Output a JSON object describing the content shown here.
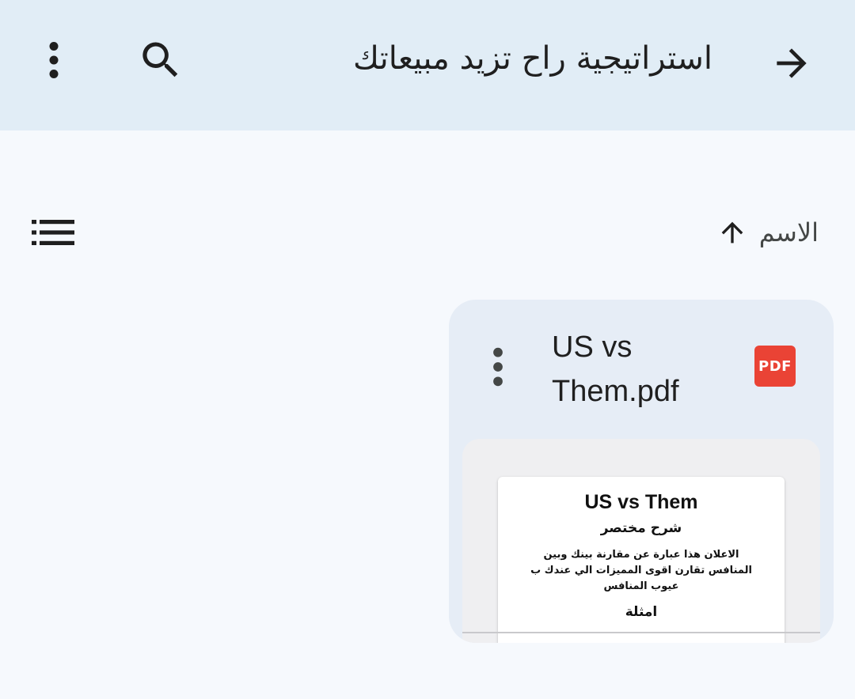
{
  "header": {
    "title": "استراتيجية راح تزيد مبيعاتك",
    "back_icon": "arrow-forward-icon",
    "search_icon": "search-icon",
    "more_icon": "more-vert-icon"
  },
  "toolbar": {
    "sort_label": "الاسم",
    "sort_direction": "ascending",
    "sort_icon": "arrow-up-icon",
    "view_toggle_icon": "list-view-icon"
  },
  "files": [
    {
      "name": "US vs Them.pdf",
      "type_badge": "PDF",
      "type_color": "#ea4335",
      "thumbnail": {
        "title": "US vs Them",
        "subtitle": "شرح مختصر",
        "body": "الاعلان هذا عبارة عن مقارنة بينك وبين المنافس تقارن اقوى المميزات الي عندك ب عيوب المنافس",
        "heading": "امثلة"
      }
    }
  ],
  "colors": {
    "header_bg": "#e1edf6",
    "page_bg": "#f6f9fd",
    "card_bg": "#e6edf6",
    "pdf_red": "#ea4335"
  }
}
